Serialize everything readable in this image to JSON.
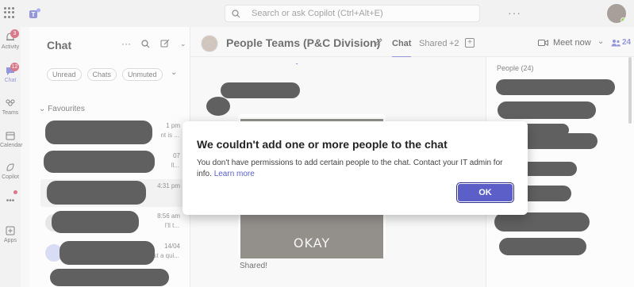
{
  "search": {
    "placeholder": "Search or ask Copilot (Ctrl+Alt+E)"
  },
  "rail": {
    "items": [
      {
        "label": "Activity",
        "badge": "3",
        "icon": "bell-icon"
      },
      {
        "label": "Chat",
        "badge": "12",
        "icon": "chat-icon"
      },
      {
        "label": "Teams",
        "icon": "teams-icon"
      },
      {
        "label": "Calendar",
        "icon": "calendar-icon"
      },
      {
        "label": "Copilot",
        "icon": "copilot-icon"
      },
      {
        "label": "Apps",
        "icon": "apps-icon"
      }
    ],
    "more": "•••"
  },
  "chatlist": {
    "title": "Chat",
    "filters": [
      "Unread",
      "Chats",
      "Unmuted"
    ],
    "section": "Favourites",
    "rows": [
      {
        "time": "1 pm",
        "preview": "nt is ..."
      },
      {
        "time": "07",
        "preview": "ll..."
      },
      {
        "time": "4:31 pm",
        "preview": ""
      },
      {
        "time": "8:56 am",
        "preview": "I'll t..."
      },
      {
        "time": "14/04",
        "preview": "Just a qui..."
      }
    ]
  },
  "header": {
    "title": "People Teams (P&C Division)",
    "tabs": [
      "Chat",
      "Shared",
      "+2"
    ],
    "meet_now": "Meet now",
    "people_count": "24"
  },
  "conversation": {
    "gif_caption": "OKAY",
    "shared_text": "Shared!"
  },
  "people_panel": {
    "title": "People (24)"
  },
  "dialog": {
    "title": "We couldn't add one or more people to the chat",
    "body": "You don't have permissions to add certain people to the chat. Contact your IT admin for info.",
    "link": "Learn more",
    "ok_label": "OK"
  },
  "colors": {
    "accent": "#5b5fc7",
    "badge": "#c4314b",
    "presence": "#6bb700"
  }
}
